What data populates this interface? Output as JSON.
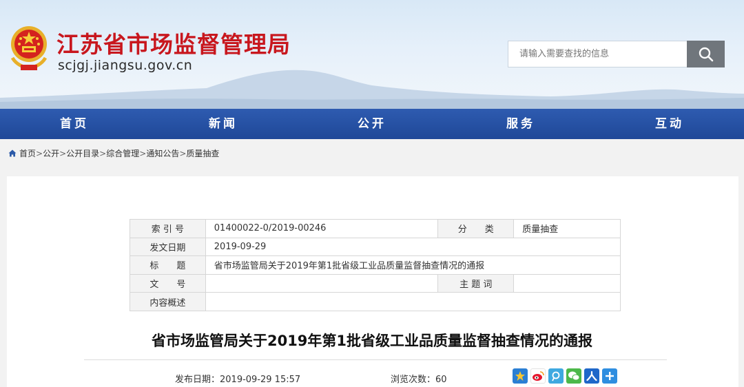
{
  "header": {
    "site_title": "江苏省市场监督管理局",
    "site_domain": "scjgj.jiangsu.gov.cn",
    "search_placeholder": "请输入需要查找的信息"
  },
  "nav": [
    "首页",
    "新闻",
    "公开",
    "服务",
    "互动"
  ],
  "breadcrumb": [
    "首页",
    "公开",
    "公开目录",
    "综合管理",
    "通知公告",
    "质量抽查"
  ],
  "meta_table": {
    "index_label": "索 引 号",
    "index_value": "01400022-0/2019-00246",
    "category_label": "分　　类",
    "category_value": "质量抽查",
    "date_label": "发文日期",
    "date_value": "2019-09-29",
    "title_label": "标　　题",
    "title_value": "省市场监管局关于2019年第1批省级工业品质量监督抽查情况的通报",
    "doc_no_label": "文　　号",
    "doc_no_value": "",
    "subject_label": "主 题 词",
    "subject_value": "",
    "summary_label": "内容概述",
    "summary_value": ""
  },
  "article": {
    "title": "省市场监管局关于2019年第1批省级工业品质量监督抽查情况的通报",
    "publish": "发布日期：2019-09-29 15:57",
    "views": "浏览次数：60"
  },
  "share_icons": [
    "qzone-icon",
    "weibo-icon",
    "tencent-weibo-icon",
    "wechat-icon",
    "renren-icon",
    "more-share-icon"
  ],
  "colors": {
    "nav": "#2452a4",
    "title_red": "#c8171e",
    "search_btn": "#70767c"
  }
}
